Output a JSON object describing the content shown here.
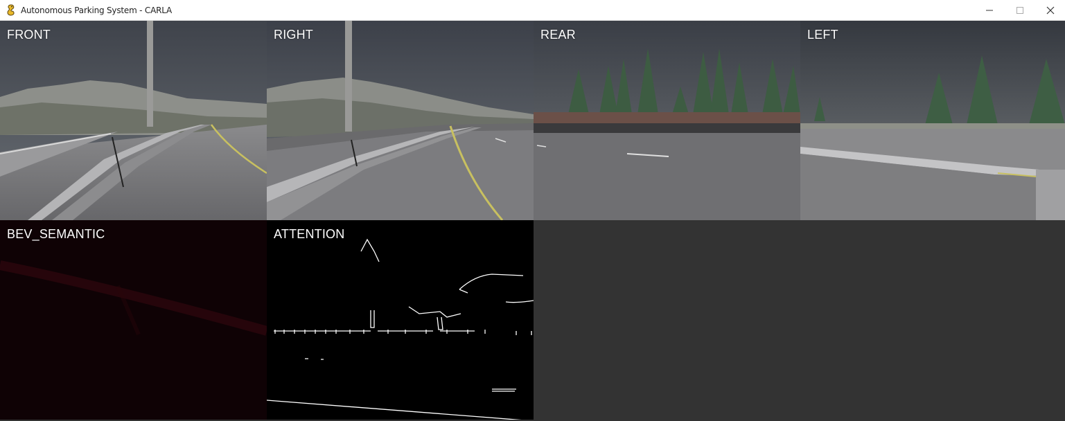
{
  "window": {
    "title": "Autonomous Parking System - CARLA",
    "icon": "pygame-snake-icon",
    "controls": [
      "minimize-icon",
      "maximize-icon",
      "close-icon"
    ]
  },
  "views": {
    "front": {
      "label": "FRONT"
    },
    "right": {
      "label": "RIGHT"
    },
    "rear": {
      "label": "REAR"
    },
    "left": {
      "label": "LEFT"
    },
    "bev": {
      "label": "BEV_SEMANTIC"
    },
    "attention": {
      "label": "ATTENTION"
    }
  },
  "colors": {
    "sky": "#4a4f58",
    "road": "#77777a",
    "lane_yellow": "#c8c060",
    "bev_background": "#0f0205",
    "empty_background": "#333333",
    "attention_edges": "#ffffff"
  }
}
